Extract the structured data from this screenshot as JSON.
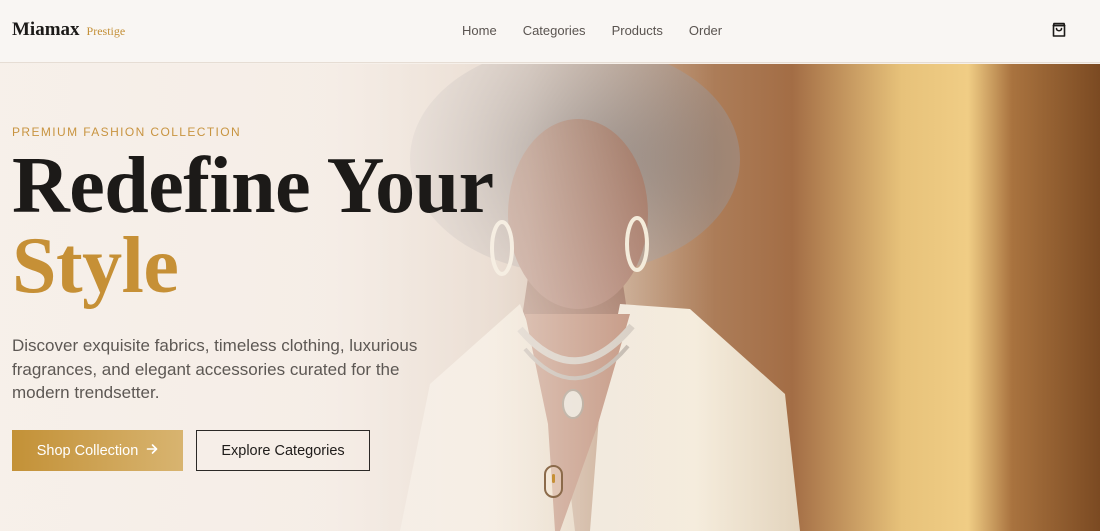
{
  "brand": {
    "name": "Miamax",
    "tagline": "Prestige"
  },
  "nav": {
    "items": [
      "Home",
      "Categories",
      "Products",
      "Order"
    ]
  },
  "cart": {
    "icon": "shopping-bag-icon"
  },
  "hero": {
    "eyebrow": "PREMIUM FASHION COLLECTION",
    "title_line1": "Redefine Your",
    "title_line2": "Style",
    "description": "Discover exquisite fabrics, timeless clothing, luxurious fragrances, and elegant accessories curated for the modern trendsetter.",
    "primary_cta": "Shop Collection",
    "primary_cta_icon": "arrow-right-icon",
    "secondary_cta": "Explore Categories",
    "scroll_icon": "mouse-scroll-icon"
  },
  "colors": {
    "accent": "#c69036",
    "text_dark": "#1c1a18",
    "text_muted": "#5d5854",
    "header_bg": "#f9f6f3"
  }
}
